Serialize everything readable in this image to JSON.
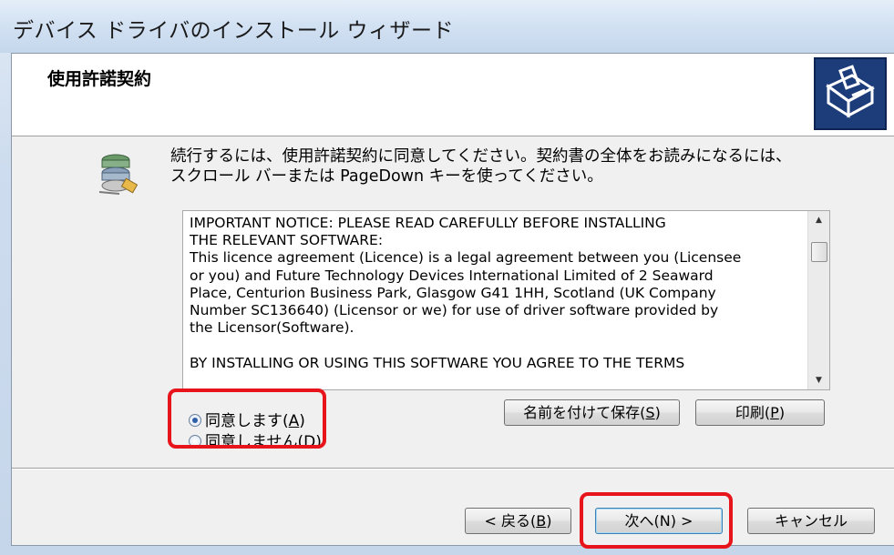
{
  "window": {
    "title": "デバイス ドライバのインストール ウィザード"
  },
  "header": {
    "title": "使用許諾契約"
  },
  "instruction": {
    "line1": "続行するには、使用許諾契約に同意してください。契約書の全体をお読みになるには、",
    "line2": "スクロール バーまたは PageDown キーを使ってください。"
  },
  "license": {
    "text": "IMPORTANT NOTICE: PLEASE READ CAREFULLY BEFORE INSTALLING\nTHE RELEVANT SOFTWARE:\nThis licence agreement (Licence) is a legal agreement between you (Licensee\nor you) and Future Technology Devices International Limited of 2 Seaward\nPlace, Centurion Business Park, Glasgow G41 1HH, Scotland (UK Company\nNumber SC136640) (Licensor or we) for use of driver software provided by\nthe Licensor(Software).\n\nBY INSTALLING OR USING THIS SOFTWARE YOU AGREE TO THE TERMS"
  },
  "options": {
    "agree_label": "同意します(",
    "agree_key": "A",
    "disagree_label": "同意しません(",
    "disagree_key": "D",
    "selected": "agree"
  },
  "buttons": {
    "save_label": "名前を付けて保存(",
    "save_key": "S",
    "print_label": "印刷(",
    "print_key": "P",
    "back_label": "< 戻る(",
    "back_key": "B",
    "next_label": "次へ(N) >",
    "cancel_label": "キャンセル"
  },
  "icons": {
    "header": "hardware-install-icon",
    "wizard": "license-scroll-icon"
  },
  "colors": {
    "highlight": "#e8141b",
    "header_icon_bg": "#1d3c7a"
  }
}
